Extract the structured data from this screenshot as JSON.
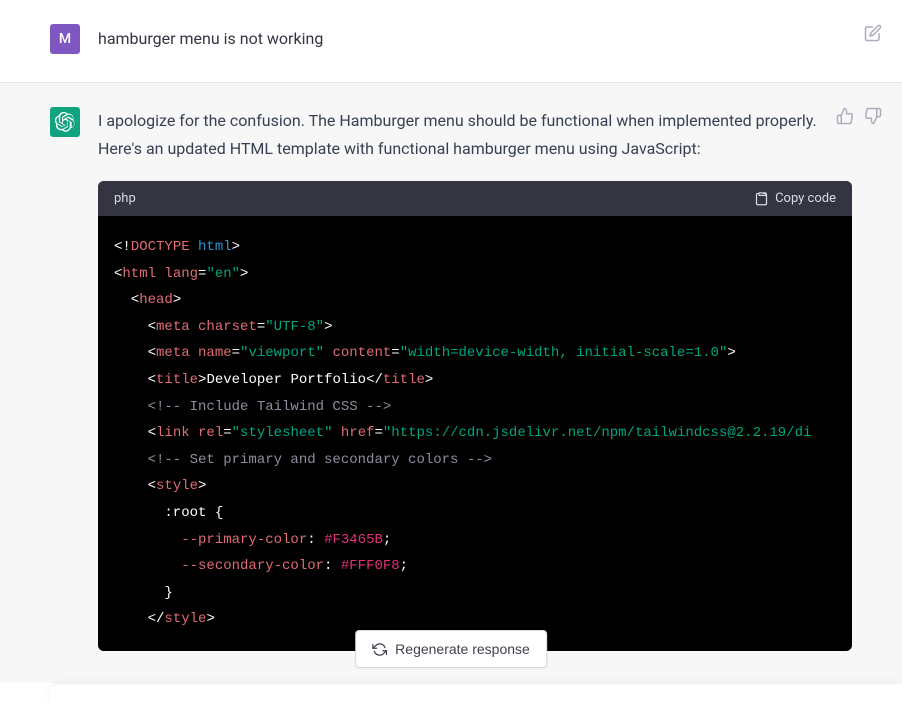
{
  "user": {
    "avatar_letter": "M",
    "message": "hamburger menu is not working"
  },
  "assistant": {
    "message": "I apologize for the confusion. The Hamburger menu should be functional when implemented properly. Here's an updated HTML template with functional hamburger menu using JavaScript:",
    "code": {
      "language": "php",
      "copy_label": "Copy code",
      "lines": [
        [
          {
            "t": "punct",
            "v": "<!"
          },
          {
            "t": "tag",
            "v": "DOCTYPE"
          },
          {
            "t": "punct",
            "v": " "
          },
          {
            "t": "keyword",
            "v": "html"
          },
          {
            "t": "punct",
            "v": ">"
          }
        ],
        [
          {
            "t": "punct",
            "v": "<"
          },
          {
            "t": "tag",
            "v": "html"
          },
          {
            "t": "punct",
            "v": " "
          },
          {
            "t": "attr",
            "v": "lang"
          },
          {
            "t": "punct",
            "v": "="
          },
          {
            "t": "string",
            "v": "\"en\""
          },
          {
            "t": "punct",
            "v": ">"
          }
        ],
        [
          {
            "t": "punct",
            "v": "  <"
          },
          {
            "t": "tag",
            "v": "head"
          },
          {
            "t": "punct",
            "v": ">"
          }
        ],
        [
          {
            "t": "punct",
            "v": "    <"
          },
          {
            "t": "tag",
            "v": "meta"
          },
          {
            "t": "punct",
            "v": " "
          },
          {
            "t": "attr",
            "v": "charset"
          },
          {
            "t": "punct",
            "v": "="
          },
          {
            "t": "string",
            "v": "\"UTF-8\""
          },
          {
            "t": "punct",
            "v": ">"
          }
        ],
        [
          {
            "t": "punct",
            "v": "    <"
          },
          {
            "t": "tag",
            "v": "meta"
          },
          {
            "t": "punct",
            "v": " "
          },
          {
            "t": "attr",
            "v": "name"
          },
          {
            "t": "punct",
            "v": "="
          },
          {
            "t": "string",
            "v": "\"viewport\""
          },
          {
            "t": "punct",
            "v": " "
          },
          {
            "t": "attr",
            "v": "content"
          },
          {
            "t": "punct",
            "v": "="
          },
          {
            "t": "string",
            "v": "\"width=device-width, initial-scale=1.0\""
          },
          {
            "t": "punct",
            "v": ">"
          }
        ],
        [
          {
            "t": "punct",
            "v": "    <"
          },
          {
            "t": "tag",
            "v": "title"
          },
          {
            "t": "punct",
            "v": ">"
          },
          {
            "t": "text",
            "v": "Developer Portfolio"
          },
          {
            "t": "punct",
            "v": "</"
          },
          {
            "t": "tag",
            "v": "title"
          },
          {
            "t": "punct",
            "v": ">"
          }
        ],
        [
          {
            "t": "comment",
            "v": "    <!-- Include Tailwind CSS -->"
          }
        ],
        [
          {
            "t": "punct",
            "v": "    <"
          },
          {
            "t": "tag",
            "v": "link"
          },
          {
            "t": "punct",
            "v": " "
          },
          {
            "t": "attr",
            "v": "rel"
          },
          {
            "t": "punct",
            "v": "="
          },
          {
            "t": "string",
            "v": "\"stylesheet\""
          },
          {
            "t": "punct",
            "v": " "
          },
          {
            "t": "attr",
            "v": "href"
          },
          {
            "t": "punct",
            "v": "="
          },
          {
            "t": "string",
            "v": "\"https://cdn.jsdelivr.net/npm/tailwindcss@2.2.19/di"
          }
        ],
        [
          {
            "t": "comment",
            "v": "    <!-- Set primary and secondary colors -->"
          }
        ],
        [
          {
            "t": "punct",
            "v": "    <"
          },
          {
            "t": "tag",
            "v": "style"
          },
          {
            "t": "punct",
            "v": ">"
          }
        ],
        [
          {
            "t": "text",
            "v": "      :root {"
          }
        ],
        [
          {
            "t": "text",
            "v": "        "
          },
          {
            "t": "prop",
            "v": "--primary-color"
          },
          {
            "t": "text",
            "v": ": "
          },
          {
            "t": "value",
            "v": "#F3465B"
          },
          {
            "t": "text",
            "v": ";"
          }
        ],
        [
          {
            "t": "text",
            "v": "        "
          },
          {
            "t": "prop",
            "v": "--secondary-color"
          },
          {
            "t": "text",
            "v": ": "
          },
          {
            "t": "value",
            "v": "#FFF0F8"
          },
          {
            "t": "text",
            "v": ";"
          }
        ],
        [
          {
            "t": "text",
            "v": "      }"
          }
        ],
        [
          {
            "t": "punct",
            "v": "    </"
          },
          {
            "t": "tag",
            "v": "style"
          },
          {
            "t": "punct",
            "v": ">"
          }
        ]
      ]
    }
  },
  "regenerate_label": "Regenerate response"
}
